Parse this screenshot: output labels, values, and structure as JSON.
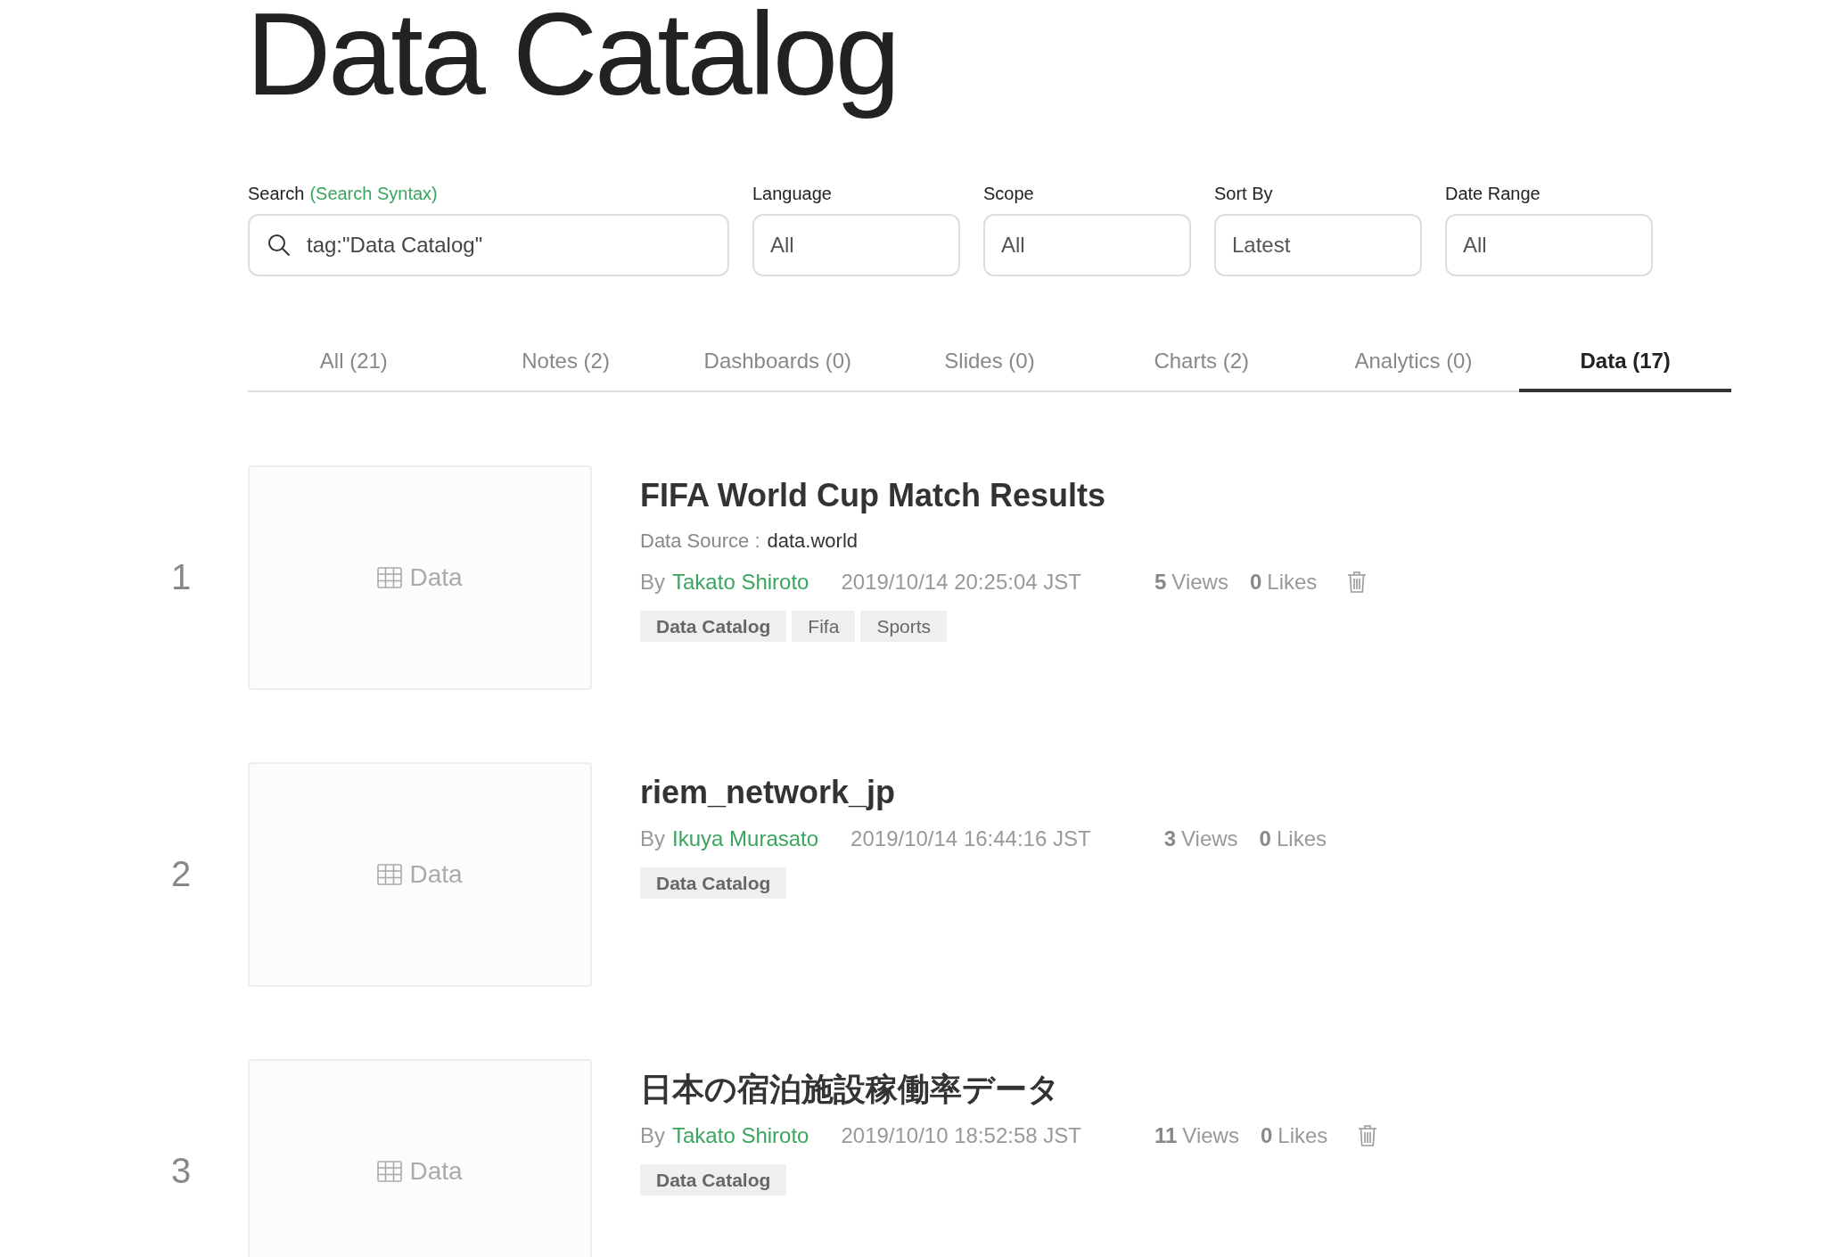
{
  "title": "Data Catalog",
  "filters": {
    "search": {
      "label": "Search",
      "link": "(Search Syntax)",
      "value": "tag:\"Data Catalog\""
    },
    "selects": [
      {
        "label": "Language",
        "value": "All"
      },
      {
        "label": "Scope",
        "value": "All"
      },
      {
        "label": "Sort By",
        "value": "Latest"
      },
      {
        "label": "Date Range",
        "value": "All"
      }
    ]
  },
  "tabs": [
    {
      "label": "All (21)",
      "selected": false
    },
    {
      "label": "Notes (2)",
      "selected": false
    },
    {
      "label": "Dashboards (0)",
      "selected": false
    },
    {
      "label": "Slides (0)",
      "selected": false
    },
    {
      "label": "Charts (2)",
      "selected": false
    },
    {
      "label": "Analytics (0)",
      "selected": false
    },
    {
      "label": "Data (17)",
      "selected": true
    }
  ],
  "items": [
    {
      "number": "1",
      "thumbnail": "Data",
      "title": "FIFA World Cup Match Results",
      "data_source": {
        "label": "Data Source :",
        "value": "data.world"
      },
      "by": "By",
      "author": "Takato Shiroto",
      "date": "2019/10/14 20:25:04 JST",
      "views": {
        "count": "5",
        "label": "Views"
      },
      "likes": {
        "count": "0",
        "label": "Likes"
      },
      "deletable": true,
      "tags": [
        {
          "label": "Data Catalog",
          "highlighted": true
        },
        {
          "label": "Fifa",
          "highlighted": false
        },
        {
          "label": "Sports",
          "highlighted": false
        }
      ]
    },
    {
      "number": "2",
      "thumbnail": "Data",
      "title": "riem_network_jp",
      "by": "By",
      "author": "Ikuya Murasato",
      "date": "2019/10/14 16:44:16 JST",
      "views": {
        "count": "3",
        "label": "Views"
      },
      "likes": {
        "count": "0",
        "label": "Likes"
      },
      "deletable": false,
      "tags": [
        {
          "label": "Data Catalog",
          "highlighted": true
        }
      ]
    },
    {
      "number": "3",
      "thumbnail": "Data",
      "title": "日本の宿泊施設稼働率データ",
      "by": "By",
      "author": "Takato Shiroto",
      "date": "2019/10/10 18:52:58 JST",
      "views": {
        "count": "11",
        "label": "Views"
      },
      "likes": {
        "count": "0",
        "label": "Likes"
      },
      "deletable": true,
      "tags": [
        {
          "label": "Data Catalog",
          "highlighted": true
        }
      ]
    }
  ]
}
